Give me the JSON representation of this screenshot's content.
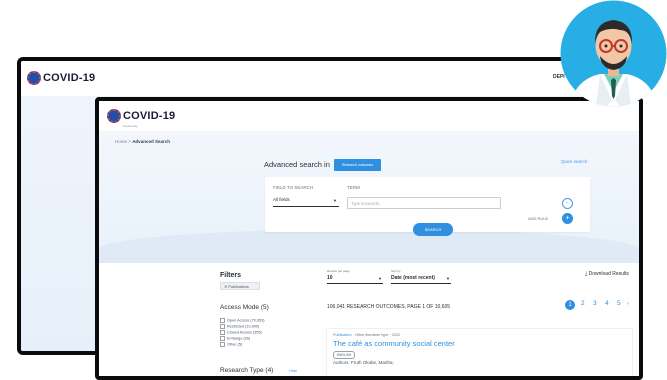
{
  "back_window": {
    "logo_text": "COVID-19",
    "right_text": "DEPI"
  },
  "front_window": {
    "logo_text": "COVID-19",
    "logo_subtext": "community",
    "breadcrumb": {
      "home": "Home",
      "separator": ">",
      "current": "Advanced Search"
    },
    "advanced_search": {
      "heading": "Advanced search in",
      "scope_pill": "Research outcomes",
      "quick_search_link": "Quick search",
      "field_label": "FIELD TO SEARCH",
      "term_label": "TERM",
      "field_value": "All fields",
      "term_placeholder": "Type keywords...",
      "add_rule_label": "ADD RULE",
      "search_button": "SEARCH"
    },
    "filters": {
      "title": "Filters",
      "active_chip": "Publications",
      "access_mode_title": "Access Mode (5)",
      "access_options": [
        "Open Access (70,953)",
        "Restricted (10,000)",
        "Closed Access (355)",
        "Embargo (26)",
        "Other (5)"
      ],
      "research_type_title": "Research Type (4)",
      "research_type_link": "Hide"
    },
    "results_bar": {
      "results_per_page_label": "Results per page",
      "results_per_page_value": "10",
      "sort_label": "Sort by",
      "sort_value": "Date (most recent)",
      "download_label": "Download Results",
      "count_text": "106,041 RESEARCH OUTCOMES, PAGE 1 OF 10,605",
      "pages": [
        "1",
        "2",
        "3",
        "4",
        "5"
      ]
    },
    "result_card": {
      "type": "Publication",
      "subtype": "Other literature type",
      "year": "2022",
      "title": "The café as community social center",
      "language_badge": "ENGLISH",
      "authors": "Authors: Fruth Okabe, Martha;"
    }
  },
  "colors": {
    "accent": "#2f8fe0",
    "avatar_bg": "#27aee4",
    "frame": "#0b0b0b"
  }
}
